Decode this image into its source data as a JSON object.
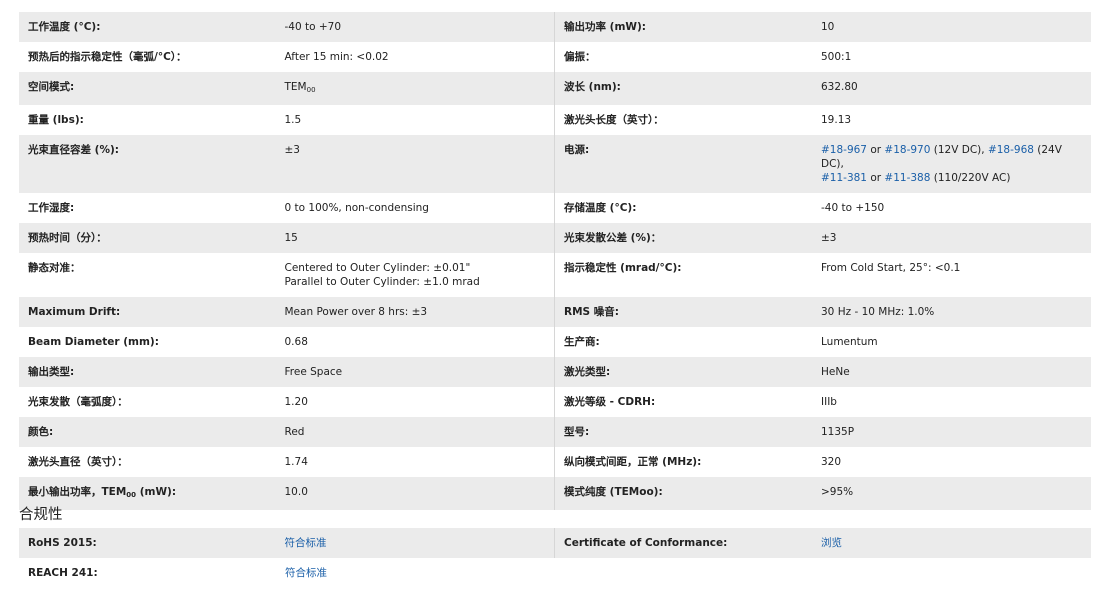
{
  "specs": [
    {
      "lk": "工作温度 (°C):",
      "lv": "-40 to +70",
      "rk": "输出功率 (mW):",
      "rv": "10"
    },
    {
      "lk": "预热后的指示稳定性（毫弧/°C）：",
      "lv": "After 15 min: <0.02",
      "rk": "偏振：",
      "rv": "500:1"
    },
    {
      "lk": "空间模式:",
      "lv_main": "TEM",
      "lv_sub": "00",
      "rk": "波长 (nm):",
      "rv": "632.80"
    },
    {
      "lk": "重量 (lbs):",
      "lv": "1.5",
      "rk": "激光头长度（英寸）：",
      "rv": "19.13"
    },
    {
      "lk": "光束直径容差 (%):",
      "lv": "±3",
      "rk": "电源:",
      "rv_power": {
        "l1": "#18-967",
        "t1": " or ",
        "l2": "#18-970",
        "t2": " (12V DC), ",
        "l3": "#18-968",
        "t3": " (24V DC),",
        "l4": "#11-381",
        "t4": " or ",
        "l5": "#11-388",
        "t5": " (110/220V AC)"
      }
    },
    {
      "lk": "工作湿度:",
      "lv": "0 to 100%, non-condensing",
      "rk": "存储温度 (°C):",
      "rv": "-40 to +150"
    },
    {
      "lk": "预热时间（分）：",
      "lv": "15",
      "rk": "光束发散公差 (%)：",
      "rv": "±3"
    },
    {
      "lk": "静态对准：",
      "lv1": "Centered to Outer Cylinder: ±0.01\"",
      "lv2": "Parallel to Outer Cylinder: ±1.0 mrad",
      "rk": "指示稳定性 (mrad/°C):",
      "rv": "From Cold Start, 25°: <0.1"
    },
    {
      "lk": "Maximum Drift:",
      "lv": "Mean Power over 8 hrs: ±3",
      "rk": "RMS 噪音:",
      "rv": "30 Hz - 10 MHz: 1.0%"
    },
    {
      "lk": "Beam Diameter (mm):",
      "lv": "0.68",
      "rk": "生产商:",
      "rv": "Lumentum"
    },
    {
      "lk": "输出类型:",
      "lv": "Free Space",
      "rk": "激光类型:",
      "rv": "HeNe"
    },
    {
      "lk": "光束发散（毫弧度）：",
      "lv": "1.20",
      "rk": "激光等级 - CDRH:",
      "rv": "IIIb"
    },
    {
      "lk": "颜色:",
      "lv": "Red",
      "rk": "型号:",
      "rv": "1135P"
    },
    {
      "lk": "激光头直径（英寸）：",
      "lv": "1.74",
      "rk": "纵向模式间距，正常 (MHz):",
      "rv": "320"
    },
    {
      "lk_main": "最小输出功率，TEM",
      "lk_sub": "00",
      "lk_tail": " (mW):",
      "lv": "10.0",
      "rk": "模式纯度 (TEMoo):",
      "rv": ">95%"
    }
  ],
  "compliance": {
    "title": "合规性",
    "rows": [
      {
        "lk": "RoHS 2015:",
        "lv": "符合标准",
        "rk": "Certificate of Conformance:",
        "rv": "浏览"
      },
      {
        "lk": "REACH 241:",
        "lv": "符合标准"
      }
    ]
  },
  "colors": {
    "stripe": "#ebebeb",
    "link": "#1a5fa8",
    "divider": "#d6d6d6"
  }
}
